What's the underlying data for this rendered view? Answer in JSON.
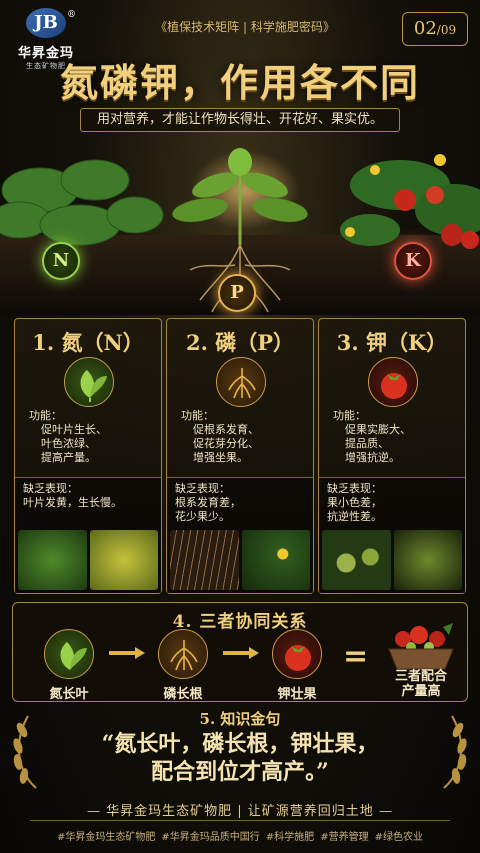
{
  "brand": {
    "logo_mark": "JB",
    "registered": "®",
    "name": "华昇金玛",
    "sub": "生态矿物肥"
  },
  "header": {
    "tagline": "《植保技术矩阵 | 科学施肥密码》",
    "page_current": "02",
    "page_total": "/09",
    "title": "氮磷钾，作用各不同",
    "subtitle": "用对营养，才能让作物长得壮、开花好、果实优。"
  },
  "scene": {
    "badges": [
      "N",
      "P",
      "K"
    ]
  },
  "cards": [
    {
      "title": "1. 氮（N）",
      "icon": "leaf-icon",
      "func_label": "功能：",
      "functions": [
        "促叶片生长、",
        "叶色浓绿、",
        "提高产量。"
      ],
      "def_label": "缺乏表现：",
      "deficiency": "叶片发黄，生长慢。"
    },
    {
      "title": "2. 磷（P）",
      "icon": "roots-icon",
      "func_label": "功能：",
      "functions": [
        "促根系发育、",
        "促花芽分化、",
        "增强坐果。"
      ],
      "def_label": "缺乏表现：",
      "deficiency_lines": [
        "根系发育差，",
        "花少果少。"
      ]
    },
    {
      "title": "3. 钾（K）",
      "icon": "tomato-icon",
      "func_label": "功能：",
      "functions": [
        "促果实膨大、",
        "提品质、",
        "增强抗逆。"
      ],
      "def_label": "缺乏表现：",
      "deficiency_lines": [
        "果小色差，",
        "抗逆性差。"
      ]
    }
  ],
  "synergy": {
    "title": "4. 三者协同关系",
    "items": [
      "氮长叶",
      "磷长根",
      "钾壮果"
    ],
    "equals": "=",
    "result_lines": [
      "三者配合",
      "产量高"
    ]
  },
  "quote": {
    "head": "5. 知识金句",
    "line1": "“氮长叶，磷长根，钾壮果，",
    "line2": "配合到位才高产。”"
  },
  "footer": {
    "slogan": "— 华昇金玛生态矿物肥 | 让矿源营养回归土地 —",
    "hashtags": [
      "#华昇金玛生态矿物肥",
      "#华昇金玛品质中国行",
      "#科学施肥",
      "#营养管理",
      "#绿色农业"
    ]
  },
  "colors": {
    "gold": "#f0cf7e",
    "frame": "#a7843b",
    "n_green": "#9bd24b",
    "p_amber": "#e8b24c",
    "k_red": "#e0553c"
  }
}
